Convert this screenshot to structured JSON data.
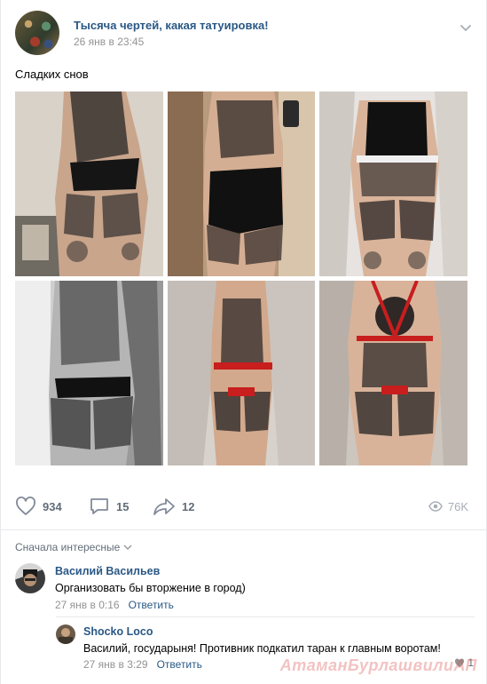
{
  "post": {
    "group_name": "Тысяча чертей, какая татуировка!",
    "date": "26 янв в 23:45",
    "text": "Сладких снов",
    "photos": [
      {
        "name": "photo-1",
        "alt": "tattooed-back-standing"
      },
      {
        "name": "photo-2",
        "alt": "tattooed-back-mirror"
      },
      {
        "name": "photo-3",
        "alt": "tattooed-back-bed"
      },
      {
        "name": "photo-4",
        "alt": "tattooed-back-bw"
      },
      {
        "name": "photo-5",
        "alt": "tattooed-back-red-straps"
      },
      {
        "name": "photo-6",
        "alt": "tattooed-back-red-harness"
      }
    ]
  },
  "actions": {
    "likes": "934",
    "comments": "15",
    "shares": "12",
    "views": "76K"
  },
  "comments": {
    "sort_label": "Сначала интересные",
    "items": [
      {
        "author": "Василий Васильев",
        "text": "Организовать бы вторжение в город)",
        "date": "27 янв в 0:16",
        "reply_label": "Ответить"
      },
      {
        "author": "Shocko Loco",
        "text": "Василий, государыня! Противник подкатил таран к главным воротам!",
        "date": "27 янв в 3:29",
        "reply_label": "Ответить",
        "likes": "1"
      }
    ]
  },
  "watermark": "АтаманБурлашвилиАП",
  "colors": {
    "link": "#2a5885",
    "muted": "#939393",
    "action": "#626d7a"
  },
  "icons": [
    "chevron-down-icon",
    "heart-icon",
    "comment-icon",
    "share-icon",
    "eye-icon",
    "sort-chevron-icon",
    "like-icon"
  ]
}
